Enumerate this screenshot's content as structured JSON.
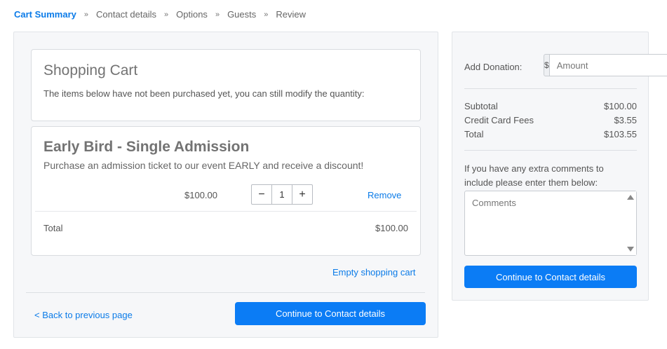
{
  "breadcrumb": {
    "items": [
      {
        "label": "Cart Summary"
      },
      {
        "label": "Contact details"
      },
      {
        "label": "Options"
      },
      {
        "label": "Guests"
      },
      {
        "label": "Review"
      }
    ],
    "separator": "»"
  },
  "cart": {
    "title": "Shopping Cart",
    "description": "The items below have not been purchased yet, you can still modify the quantity:"
  },
  "item": {
    "title": "Early Bird - Single Admission",
    "description": "Purchase an admission ticket to our event EARLY and receive a discount!",
    "price": "$100.00",
    "quantity": "1",
    "decrease_symbol": "−",
    "increase_symbol": "+",
    "remove_label": "Remove",
    "total_label": "Total",
    "total_value": "$100.00"
  },
  "actions": {
    "empty_cart": "Empty shopping cart",
    "back": "< Back to previous page",
    "continue": "Continue to Contact details"
  },
  "sidebar": {
    "donation_label": "Add Donation:",
    "currency_symbol": "$",
    "amount_placeholder": "Amount",
    "subtotal_label": "Subtotal",
    "subtotal_value": "$100.00",
    "fees_label": "Credit Card Fees",
    "fees_value": "$3.55",
    "total_label": "Total",
    "total_value": "$103.55",
    "comments_note": "If you have any extra comments to include please enter them below:",
    "comments_placeholder": "Comments",
    "continue": "Continue to Contact details"
  },
  "colors": {
    "accent": "#0b7be8",
    "primary_button": "#0b7cf5",
    "panel_bg": "#f6f7f9"
  }
}
